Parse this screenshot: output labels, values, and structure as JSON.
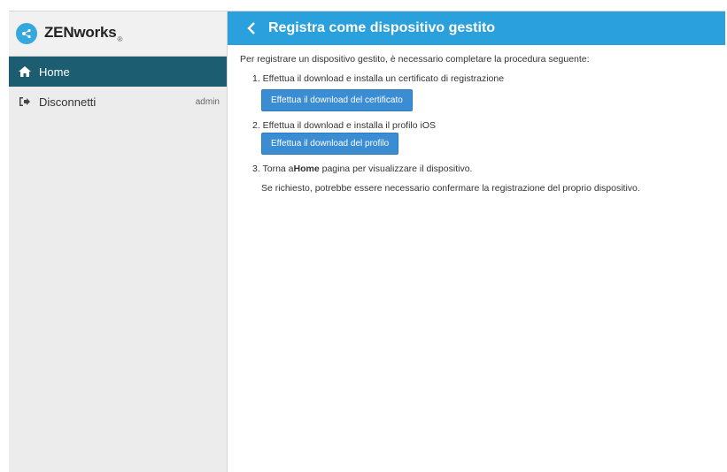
{
  "brand": {
    "name": "ZENworks",
    "registered": "®"
  },
  "sidebar": {
    "items": [
      {
        "label": "Home",
        "icon": "home-icon",
        "active": true
      },
      {
        "label": "Disconnetti",
        "icon": "sign-out-icon",
        "user": "admin"
      }
    ]
  },
  "header": {
    "title": "Registra come dispositivo gestito",
    "back_icon": "chevron-left-icon"
  },
  "main": {
    "intro": "Per registrare un dispositivo gestito, è necessario completare la procedura seguente:",
    "step1": {
      "text": "1. Effettua il download e installa un certificato di registrazione",
      "button": "Effettua il download del certificato"
    },
    "step2": {
      "text": "2. Effettua il download e installa il profilo iOS",
      "button": "Effettua il download del profilo"
    },
    "step3": {
      "prefix": "3. Torna a",
      "bold": "Home",
      "suffix": " pagina per visualizzare il dispositivo."
    },
    "note": "Se richiesto, potrebbe essere necessario confermare la registrazione del proprio dispositivo."
  },
  "colors": {
    "header_bg": "#2aa0dc",
    "active_nav_bg": "#1d5d72",
    "button_bg": "#3a8cd3",
    "sidebar_bg": "#ececec"
  }
}
